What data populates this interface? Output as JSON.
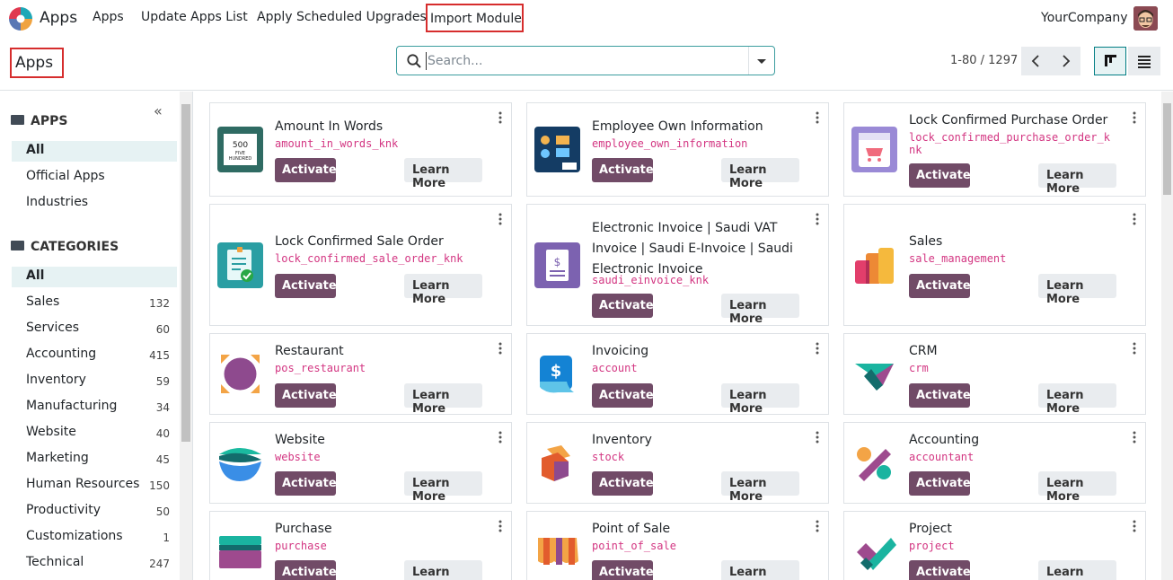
{
  "navbar": {
    "brand": "Apps",
    "menu": [
      "Apps",
      "Update Apps List",
      "Apply Scheduled Upgrades"
    ],
    "import_module": "Import Module",
    "company": "YourCompany"
  },
  "control": {
    "title": "Apps",
    "search_placeholder": "Search...",
    "pager": "1-80 / 1297"
  },
  "sidebar": {
    "apps_header": "APPS",
    "apps_items": [
      "All",
      "Official Apps",
      "Industries"
    ],
    "categories_header": "CATEGORIES",
    "categories_all": "All",
    "categories": [
      {
        "label": "Sales",
        "count": "132"
      },
      {
        "label": "Services",
        "count": "60"
      },
      {
        "label": "Accounting",
        "count": "415"
      },
      {
        "label": "Inventory",
        "count": "59"
      },
      {
        "label": "Manufacturing",
        "count": "34"
      },
      {
        "label": "Website",
        "count": "40"
      },
      {
        "label": "Marketing",
        "count": "45"
      },
      {
        "label": "Human Resources",
        "count": "150"
      },
      {
        "label": "Productivity",
        "count": "50"
      },
      {
        "label": "Customizations",
        "count": "1"
      },
      {
        "label": "Technical",
        "count": "247"
      }
    ]
  },
  "cards_labels": {
    "activate": "Activate",
    "learn_more": "Learn More"
  },
  "cards": [
    {
      "title": "Amount In Words",
      "tech": "amount_in_words_knk",
      "icon_name": "amount-in-words-icon",
      "icon_text": "500 FIVE HUNDRED"
    },
    {
      "title": "Employee Own Information",
      "tech": "employee_own_information",
      "icon_name": "employee-info-icon"
    },
    {
      "title": "Lock Confirmed Purchase Order",
      "tech": "lock_confirmed_purchase_order_knk",
      "icon_name": "lock-purchase-order-icon"
    },
    {
      "title": "Lock Confirmed Sale Order",
      "tech": "lock_confirmed_sale_order_knk",
      "icon_name": "lock-sale-order-icon"
    },
    {
      "title": "Electronic Invoice | Saudi VAT Invoice | Saudi E-Invoice | Saudi Electronic Invoice",
      "tech": "saudi_einvoice_knk",
      "icon_name": "saudi-einvoice-icon"
    },
    {
      "title": "Sales",
      "tech": "sale_management",
      "icon_name": "sales-icon"
    },
    {
      "title": "Restaurant",
      "tech": "pos_restaurant",
      "icon_name": "restaurant-icon"
    },
    {
      "title": "Invoicing",
      "tech": "account",
      "icon_name": "invoicing-icon"
    },
    {
      "title": "CRM",
      "tech": "crm",
      "icon_name": "crm-icon"
    },
    {
      "title": "Website",
      "tech": "website",
      "icon_name": "website-icon"
    },
    {
      "title": "Inventory",
      "tech": "stock",
      "icon_name": "inventory-icon"
    },
    {
      "title": "Accounting",
      "tech": "accountant",
      "icon_name": "accounting-icon"
    },
    {
      "title": "Purchase",
      "tech": "purchase",
      "icon_name": "purchase-icon"
    },
    {
      "title": "Point of Sale",
      "tech": "point_of_sale",
      "icon_name": "point-of-sale-icon"
    },
    {
      "title": "Project",
      "tech": "project",
      "icon_name": "project-icon"
    }
  ],
  "colors": {
    "primary": "#714b67",
    "accent": "#017e84",
    "highlight": "#d62d2d",
    "tech_name": "#d33682"
  }
}
